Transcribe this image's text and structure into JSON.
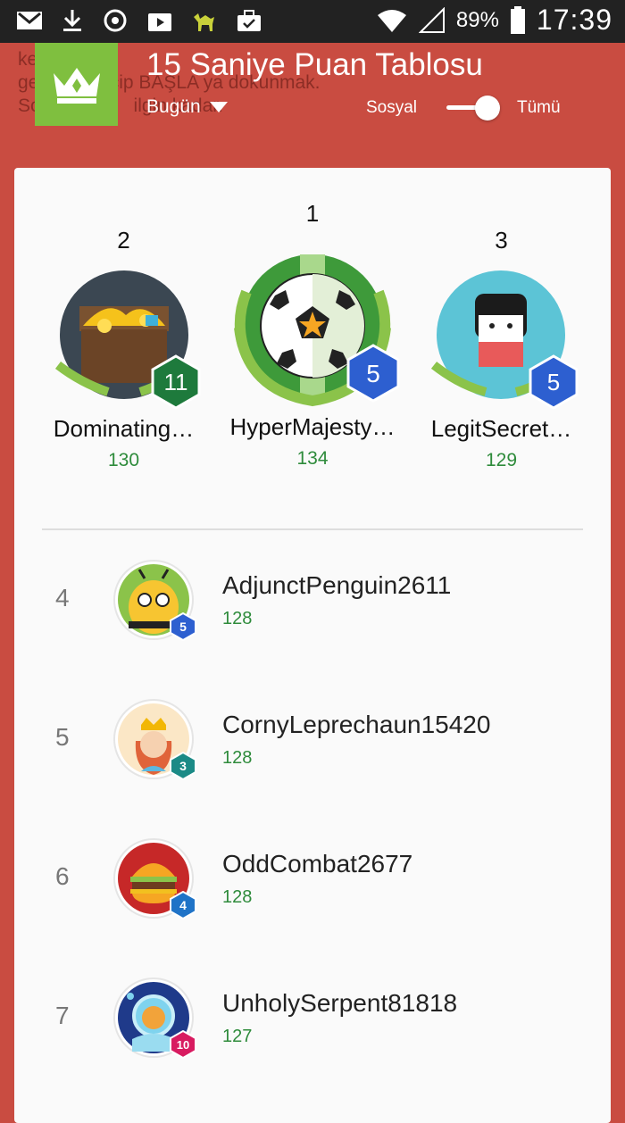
{
  "status_bar": {
    "battery": "89%",
    "time": "17:39",
    "icons": [
      "gmail-icon",
      "download-icon",
      "sync-icon",
      "media-icon",
      "camel-icon",
      "briefcase-icon",
      "wifi-icon",
      "signal-icon",
      "battery-icon"
    ]
  },
  "header": {
    "bg_hint": "ke...zır h...\nge...reyi seçip BAŞLA ya dokunmak.\nSo...    sa...    ilgin kadar.",
    "title": "15 Saniye Puan Tablosu",
    "period": "Bugün",
    "social_label": "Sosyal",
    "all_label": "Tümü",
    "accent": "#7fbf3f"
  },
  "podium": [
    {
      "rank": "2",
      "name": "Dominating…",
      "score": "130",
      "level": "11",
      "badge_color": "#1e7a3c",
      "avatar": "treasure-chest-avatar"
    },
    {
      "rank": "1",
      "name": "HyperMajesty…",
      "score": "134",
      "level": "5",
      "badge_color": "#2d5fd0",
      "avatar": "soccer-ball-avatar"
    },
    {
      "rank": "3",
      "name": "LegitSecret…",
      "score": "129",
      "level": "5",
      "badge_color": "#2d5fd0",
      "avatar": "kokeshi-doll-avatar"
    }
  ],
  "list": [
    {
      "rank": "4",
      "name": "AdjunctPenguin2611",
      "score": "128",
      "level": "5",
      "badge_color": "#2d5fd0",
      "avatar": "bee-avatar"
    },
    {
      "rank": "5",
      "name": "CornyLeprechaun15420",
      "score": "128",
      "level": "3",
      "badge_color": "#1b8a86",
      "avatar": "queen-avatar"
    },
    {
      "rank": "6",
      "name": "OddCombat2677",
      "score": "128",
      "level": "4",
      "badge_color": "#1f73c7",
      "avatar": "burger-avatar"
    },
    {
      "rank": "7",
      "name": "UnholySerpent81818",
      "score": "127",
      "level": "10",
      "badge_color": "#d81b60",
      "avatar": "astronaut-cat-avatar"
    }
  ]
}
